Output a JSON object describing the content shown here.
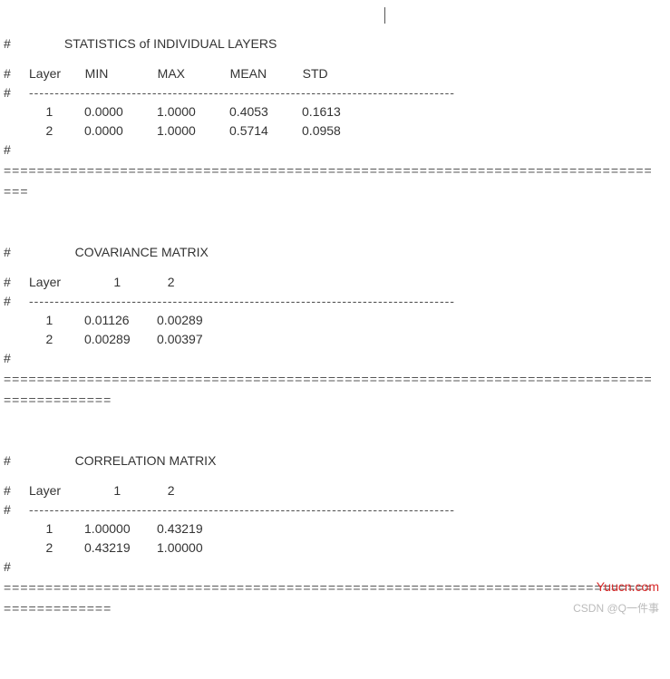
{
  "cursor": "|",
  "hash": "#",
  "dashRule": "-----------------------------------------------------------------------------------",
  "eqRule1a": "==============================================================================",
  "eqRule1b": "===",
  "eqRule2a": "==============================================================================",
  "eqRule2b": "=============",
  "eqRule3a": "==============================================================================",
  "eqRule3b": "=============",
  "section1": {
    "title": "STATISTICS of INDIVIDUAL LAYERS",
    "headers": {
      "layer": "Layer",
      "min": "MIN",
      "max": "MAX",
      "mean": "MEAN",
      "std": "STD"
    },
    "rows": [
      {
        "layer": "1",
        "min": "0.0000",
        "max": "1.0000",
        "mean": "0.4053",
        "std": "0.1613"
      },
      {
        "layer": "2",
        "min": "0.0000",
        "max": "1.0000",
        "mean": "0.5714",
        "std": "0.0958"
      }
    ]
  },
  "section2": {
    "title": "COVARIANCE MATRIX",
    "headers": {
      "layer": "Layer",
      "c1": "1",
      "c2": "2"
    },
    "rows": [
      {
        "layer": "1",
        "c1": "0.01126",
        "c2": "0.00289"
      },
      {
        "layer": "2",
        "c1": "0.00289",
        "c2": "0.00397"
      }
    ]
  },
  "section3": {
    "title": "CORRELATION MATRIX",
    "headers": {
      "layer": "Layer",
      "c1": "1",
      "c2": "2"
    },
    "rows": [
      {
        "layer": "1",
        "c1": "1.00000",
        "c2": "0.43219"
      },
      {
        "layer": "2",
        "c1": "0.43219",
        "c2": "1.00000"
      }
    ]
  },
  "watermark": "Yuucn.com",
  "credit": "CSDN @Q一件事"
}
